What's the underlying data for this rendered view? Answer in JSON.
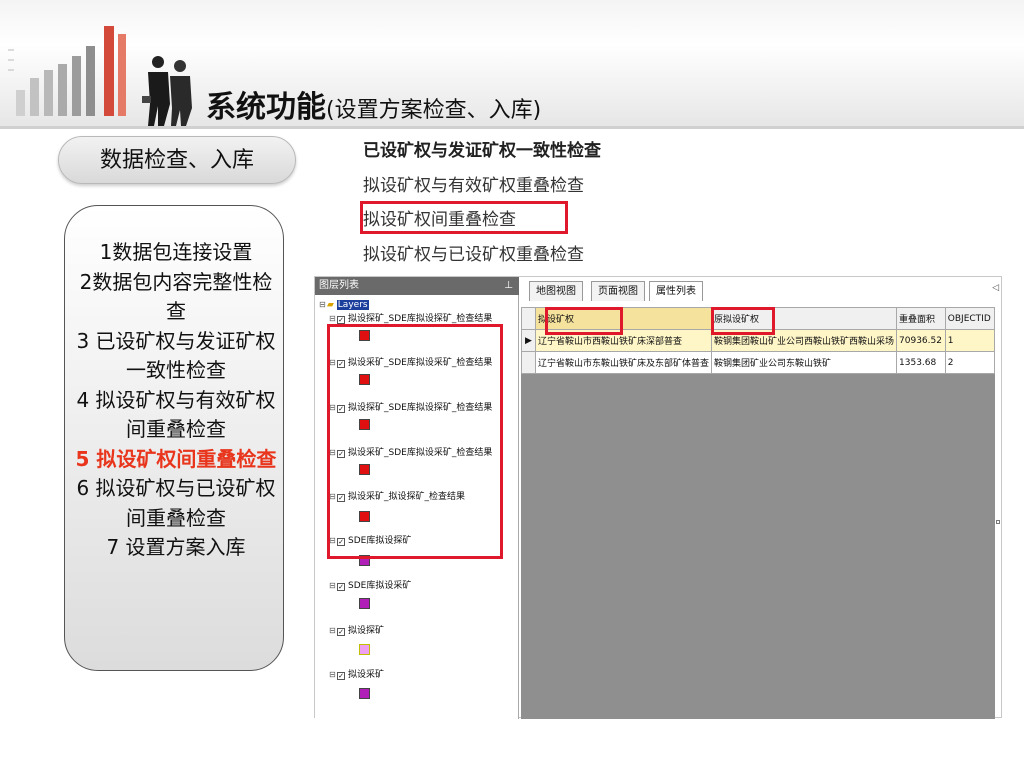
{
  "header": {
    "title_main": "系统功能",
    "title_sub": "(设置方案检查、入库)"
  },
  "left": {
    "pill_label": "数据检查、入库",
    "steps": [
      {
        "text": "1数据包连接设置"
      },
      {
        "text": "2数据包内容完整性检查"
      },
      {
        "text": "3 已设矿权与发证矿权一致性检查"
      },
      {
        "text": "4 拟设矿权与有效矿权间重叠检查"
      },
      {
        "text": "5 拟设矿权间重叠检查",
        "highlight": true
      },
      {
        "text": "6 拟设矿权与已设矿权间重叠检查"
      },
      {
        "text": "7 设置方案入库"
      }
    ]
  },
  "checks": {
    "items": [
      {
        "label": "已设矿权与发证矿权一致性检查"
      },
      {
        "label": "拟设矿权与有效矿权重叠检查"
      },
      {
        "label": "拟设矿权间重叠检查"
      },
      {
        "label": "拟设矿权与已设矿权重叠检查"
      }
    ]
  },
  "app": {
    "layer_panel_title": "图层列表",
    "pin_icon": "pin-icon",
    "tree_root": "Layers",
    "tree": [
      {
        "label": "拟设探矿_SDE库拟设探矿_检查结果",
        "color": "#e01010"
      },
      {
        "label": "拟设采矿_SDE库拟设采矿_检查结果",
        "color": "#e01010"
      },
      {
        "label": "拟设探矿_SDE库拟设探矿_检查结果",
        "color": "#e01010"
      },
      {
        "label": "拟设采矿_SDE库拟设采矿_检查结果",
        "color": "#e01010"
      },
      {
        "label": "拟设采矿_拟设探矿_检查结果",
        "color": "#e01010"
      },
      {
        "label": "SDE库拟设探矿",
        "color": "#b020b8"
      },
      {
        "label": "SDE库拟设采矿",
        "color": "#b020b8"
      },
      {
        "label": "拟设探矿",
        "color": "#f0a0f0"
      },
      {
        "label": "拟设采矿",
        "color": "#b020b8"
      }
    ],
    "tabs": [
      "地图视图",
      "页面视图",
      "属性列表"
    ],
    "table": {
      "columns": [
        "拟设矿权",
        "原拟设矿权",
        "重叠面积",
        "OBJECTID"
      ],
      "rows": [
        {
          "c1": "辽宁省鞍山市西鞍山铁矿床深部普查",
          "c2": "鞍钢集团鞍山矿业公司西鞍山铁矿西鞍山采场",
          "c3": "70936.52",
          "c4": "1"
        },
        {
          "c1": "辽宁省鞍山市东鞍山铁矿床及东部矿体普查",
          "c2": "鞍钢集团矿业公司东鞍山铁矿",
          "c3": "1353.68",
          "c4": "2"
        }
      ]
    }
  }
}
